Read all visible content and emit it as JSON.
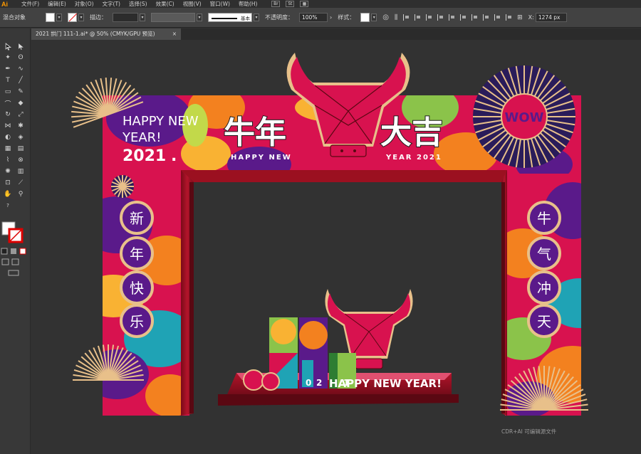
{
  "app": {
    "logo": "Ai"
  },
  "menu": {
    "items": [
      "文件(F)",
      "编辑(E)",
      "对象(O)",
      "文字(T)",
      "选择(S)",
      "效果(C)",
      "视图(V)",
      "窗口(W)",
      "帮助(H)"
    ],
    "right_buttons": [
      "Br",
      "St"
    ]
  },
  "control_bar": {
    "selection_label": "混合对象",
    "stroke_label": "描边：",
    "stroke_style": "基本",
    "opacity_label": "不透明度：",
    "opacity_value": "100%",
    "style_label": "样式：",
    "x_label": "X:",
    "x_value": "1274 px"
  },
  "document": {
    "tab_title": "2021 拱门 111-1.ai* @ 50% (CMYK/GPU 预览)",
    "close_glyph": "×"
  },
  "artwork": {
    "headline_left": "牛年",
    "headline_right": "大吉",
    "subline_left": "HAPPY NEW",
    "subline_right": "YEAR 2021",
    "greeting_line1": "HAPPY NEW",
    "greeting_line2": "YEAR!",
    "greeting_year": "2021",
    "greeting_dot": ".",
    "left_medallions": [
      "新",
      "年",
      "快",
      "乐"
    ],
    "right_medallions": [
      "牛",
      "气",
      "冲",
      "天"
    ],
    "fan_badge_text": "WOW",
    "stage_text": "HAPPY NEW YEAR!",
    "stage_digits": [
      "2",
      "0",
      "2",
      "1"
    ]
  },
  "colors": {
    "arch_red": "#d8124f",
    "frame_red": "#9b1020",
    "gold": "#e8c08a",
    "purple": "#5a1a8a",
    "orange": "#f3811f",
    "teal": "#1fa3b5",
    "canvas_bg": "#323232"
  },
  "watermark": "CDR+AI 可编辑源文件"
}
